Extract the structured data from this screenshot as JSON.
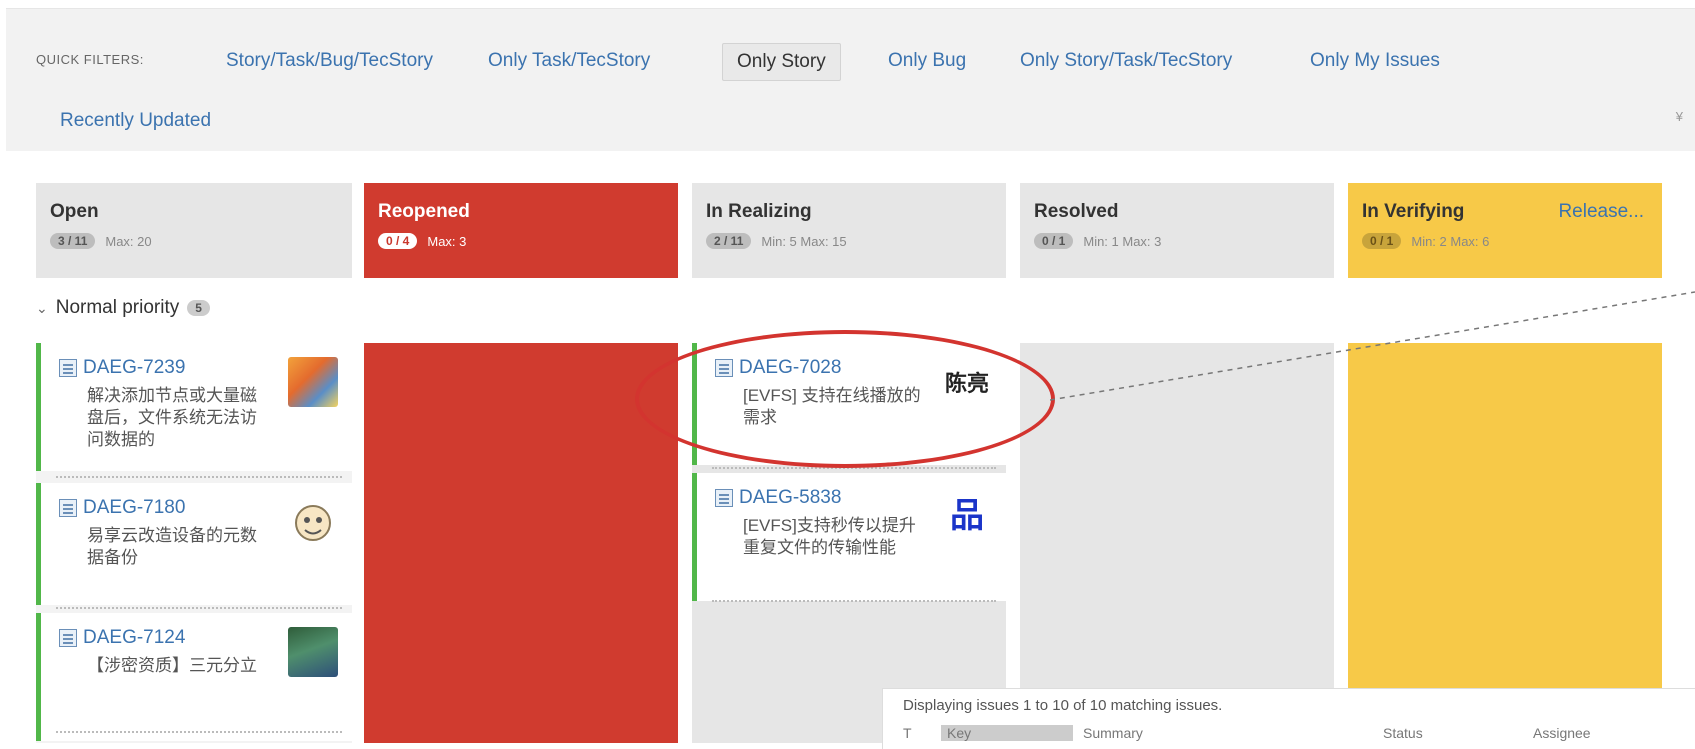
{
  "quick_filters": {
    "label": "QUICK FILTERS:",
    "items": [
      "Story/Task/Bug/TecStory",
      "Only Task/TecStory",
      "Only Story",
      "Only Bug",
      "Only Story/Task/TecStory",
      "Only My Issues",
      "Recently Updated"
    ],
    "active": "Only Story",
    "collapse_icon": "double-chevron-down-icon"
  },
  "columns": [
    {
      "name": "Open",
      "count": "3 / 11",
      "constraints": "Max: 20"
    },
    {
      "name": "Reopened",
      "count": "0 / 4",
      "constraints": "Max: 3"
    },
    {
      "name": "In Realizing",
      "count": "2 / 11",
      "constraints": "Min: 5   Max: 15"
    },
    {
      "name": "Resolved",
      "count": "0 / 1",
      "constraints": "Min: 1   Max: 3"
    },
    {
      "name": "In Verifying",
      "count": "0 / 1",
      "constraints": "Min: 2   Max: 6",
      "extra_link": "Release..."
    }
  ],
  "swimlane": {
    "label": "Normal priority",
    "count": "5"
  },
  "cards": {
    "open": [
      {
        "key": "DAEG-7239",
        "summary": "解决添加节点或大量磁盘后，文件系统无法访问数据的"
      },
      {
        "key": "DAEG-7180",
        "summary": "易享云改造设备的元数据备份"
      },
      {
        "key": "DAEG-7124",
        "summary": "【涉密资质】三元分立"
      }
    ],
    "in_realizing": [
      {
        "key": "DAEG-7028",
        "summary": "[EVFS] 支持在线播放的需求",
        "avatar_text": "陈亮"
      },
      {
        "key": "DAEG-5838",
        "summary": "[EVFS]支持秒传以提升重复文件的传输性能",
        "avatar_text": "品"
      }
    ]
  },
  "issues_panel": {
    "text": "Displaying issues 1 to 10 of 10 matching issues.",
    "headers": [
      "T",
      "Key",
      "Summary",
      "Status",
      "Assignee"
    ]
  },
  "colors": {
    "red_column": "#d03b2f",
    "yellow_column": "#f7c948",
    "grey_column": "#e6e6e6",
    "link": "#3b73af",
    "card_border": "#51b749"
  }
}
